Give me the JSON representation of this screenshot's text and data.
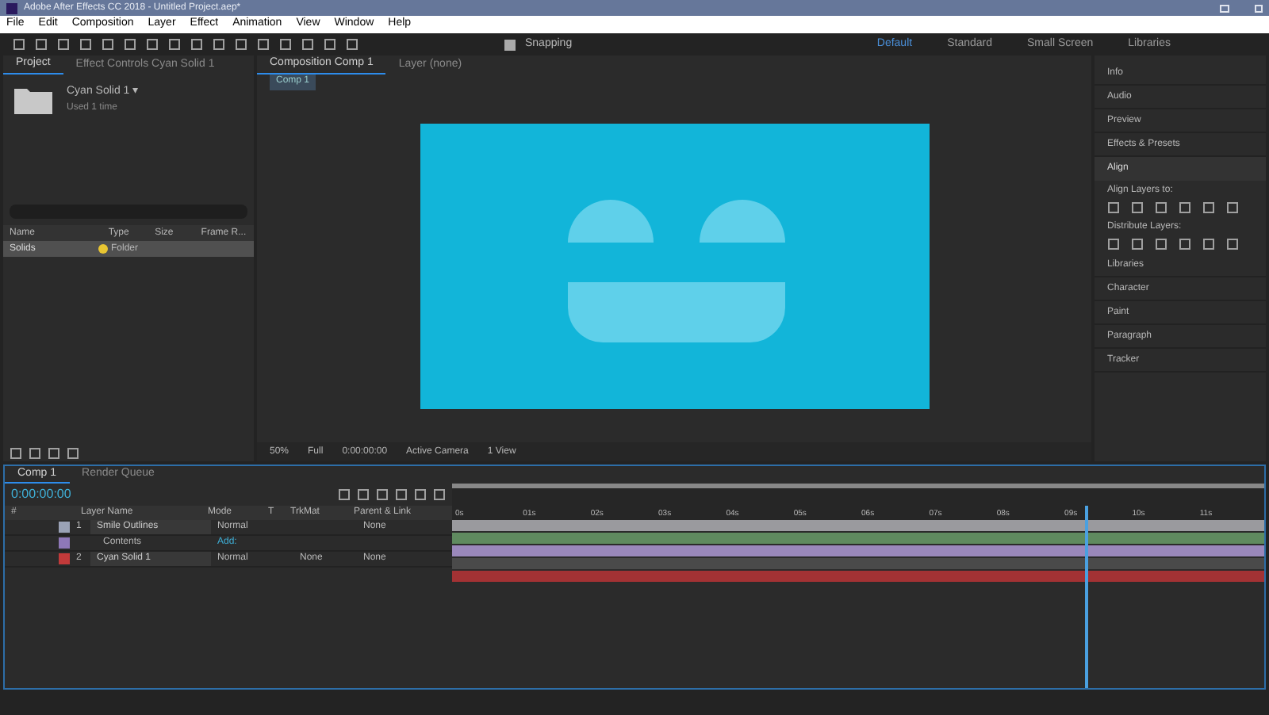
{
  "window": {
    "title": "Adobe After Effects CC 2018 - Untitled Project.aep*"
  },
  "menu": [
    "File",
    "Edit",
    "Composition",
    "Layer",
    "Effect",
    "Animation",
    "View",
    "Window",
    "Help"
  ],
  "toolbar": {
    "snapping": {
      "label": "Snapping",
      "checked": true
    }
  },
  "workspaces": [
    {
      "label": "Default",
      "selected": true
    },
    {
      "label": "Standard",
      "selected": false
    },
    {
      "label": "Small Screen",
      "selected": false
    },
    {
      "label": "Libraries",
      "selected": false
    }
  ],
  "project_panel": {
    "tabs": [
      {
        "label": "Project",
        "selected": true
      },
      {
        "label": "Effect Controls Cyan Solid 1",
        "selected": false
      }
    ],
    "item_name": "Cyan Solid 1 ▾",
    "item_info": "Used 1 time",
    "columns": [
      "Name",
      "Type",
      "Size",
      "Frame R..."
    ],
    "rows": [
      {
        "name": "Solids",
        "type": "Folder",
        "color": "#e8c532",
        "selected": true
      }
    ]
  },
  "composition_panel": {
    "tabs": [
      {
        "label": "Composition Comp 1",
        "selected": true
      },
      {
        "label": "Layer (none)",
        "selected": false
      }
    ],
    "subtab": "Comp 1",
    "footer": [
      "50%",
      "Full",
      "0:00:00:00",
      "Active Camera",
      "1 View"
    ]
  },
  "right_panel": {
    "items": [
      {
        "label": "Info",
        "kind": "header"
      },
      {
        "label": "Audio",
        "kind": "header"
      },
      {
        "label": "Preview",
        "kind": "header"
      },
      {
        "label": "Effects & Presets",
        "kind": "header"
      },
      {
        "label": "Align",
        "kind": "open"
      },
      {
        "label": "Align Layers to:",
        "kind": "tools"
      },
      {
        "label": "Distribute Layers:",
        "kind": "tools"
      },
      {
        "label": "Libraries",
        "kind": "header"
      },
      {
        "label": "Character",
        "kind": "header"
      },
      {
        "label": "Paint",
        "kind": "header"
      },
      {
        "label": "Paragraph",
        "kind": "header"
      },
      {
        "label": "Tracker",
        "kind": "header"
      }
    ]
  },
  "timeline": {
    "tabs": [
      {
        "label": "Comp 1",
        "selected": true
      },
      {
        "label": "Render Queue",
        "selected": false
      }
    ],
    "timecode": "0:00:00:00",
    "columns": [
      "#",
      "Layer Name",
      "Mode",
      "T",
      "TrkMat",
      "Parent & Link"
    ],
    "layers": [
      {
        "kind": "layer",
        "index": "1",
        "name": "Smile Outlines",
        "mode": "Normal",
        "parent": "None",
        "color": "#9aa2b6"
      },
      {
        "kind": "property",
        "name": "Contents",
        "mode": "Add:",
        "color": "#8e78b8"
      },
      {
        "kind": "layer",
        "index": "2",
        "name": "Cyan Solid 1",
        "mode": "Normal",
        "trkmat": "None",
        "parent": "None",
        "color": "#c23a3a"
      }
    ],
    "ruler": [
      "0s",
      "01s",
      "02s",
      "03s",
      "04s",
      "05s",
      "06s",
      "07s",
      "08s",
      "09s",
      "10s",
      "11s"
    ],
    "tracks": [
      {
        "color": "#9a9a9e"
      },
      {
        "color": "#5f8a5f"
      },
      {
        "color": "#9a88bb"
      },
      {
        "color": "#4a4a4a"
      },
      {
        "color": "#a33234"
      }
    ],
    "playhead": {
      "level": 0.78
    }
  }
}
